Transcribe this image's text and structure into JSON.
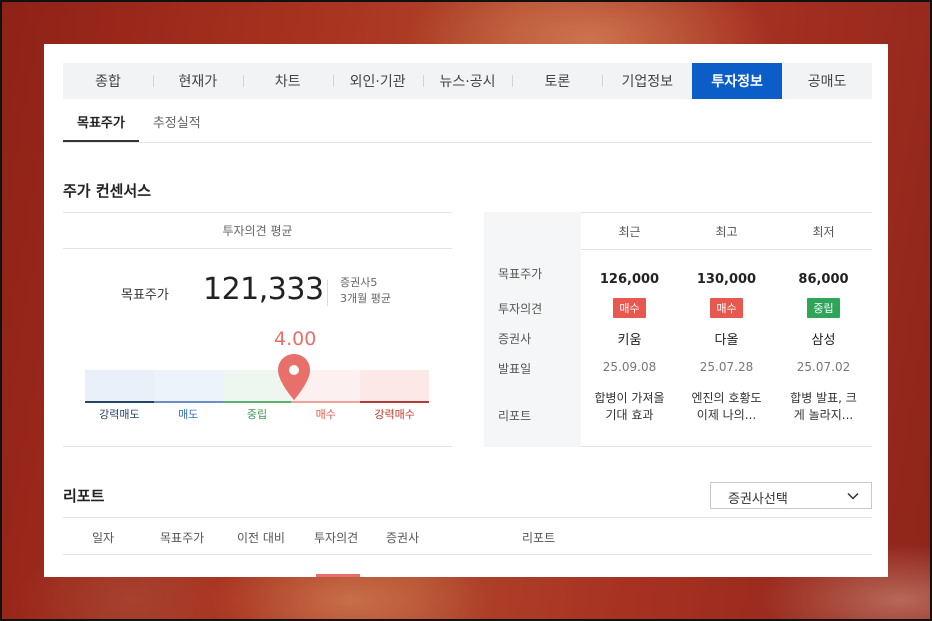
{
  "top_tabs": [
    "종합",
    "현재가",
    "차트",
    "외인·기관",
    "뉴스·공시",
    "토론",
    "기업정보",
    "투자정보",
    "공매도"
  ],
  "top_tab_active": "투자정보",
  "sub_tabs": [
    "목표주가",
    "추정실적"
  ],
  "sub_tab_active": "목표주가",
  "consensus": {
    "title": "주가 컨센서스",
    "opinion_header": "투자의견 평균",
    "target_label": "목표주가",
    "target_value": "121,333",
    "broker_count": "증권사5",
    "period": "3개월 평균",
    "score": "4.00",
    "score_value": 4.0,
    "scale_labels": [
      "강력매도",
      "매도",
      "중립",
      "매수",
      "강력매수"
    ],
    "colors": {
      "seg": [
        "#eaf0f9",
        "#edf3fb",
        "#edf6ef",
        "#fdf0f0",
        "#fde8e8"
      ],
      "line": [
        "#27446b",
        "#6b8fc4",
        "#5bb070",
        "#f0a19b",
        "#b53b3b"
      ],
      "label": [
        "#27446b",
        "#3d6fbf",
        "#3c9a55",
        "#e8584f",
        "#c0392b"
      ],
      "pin": "#e8706a"
    }
  },
  "summary_table": {
    "columns": [
      "최근",
      "최고",
      "최저"
    ],
    "row_labels": [
      "목표주가",
      "투자의견",
      "증권사",
      "발표일",
      "리포트"
    ],
    "target_prices": [
      "126,000",
      "130,000",
      "86,000"
    ],
    "opinions": [
      {
        "label": "매수",
        "type": "buy"
      },
      {
        "label": "매수",
        "type": "buy"
      },
      {
        "label": "중립",
        "type": "hold"
      }
    ],
    "brokers": [
      "키움",
      "다올",
      "삼성"
    ],
    "dates": [
      "25.09.08",
      "25.07.28",
      "25.07.02"
    ],
    "reports": [
      [
        "합병이 가져올",
        "기대 효과"
      ],
      [
        "엔진의 호황도",
        "이제 나의..."
      ],
      [
        "합병 발표, 크",
        "게 놀라지..."
      ]
    ]
  },
  "report": {
    "title": "리포트",
    "select_label": "증권사선택",
    "columns": [
      "일자",
      "목표주가",
      "이전 대비",
      "투자의견",
      "증권사",
      "리포트"
    ]
  }
}
